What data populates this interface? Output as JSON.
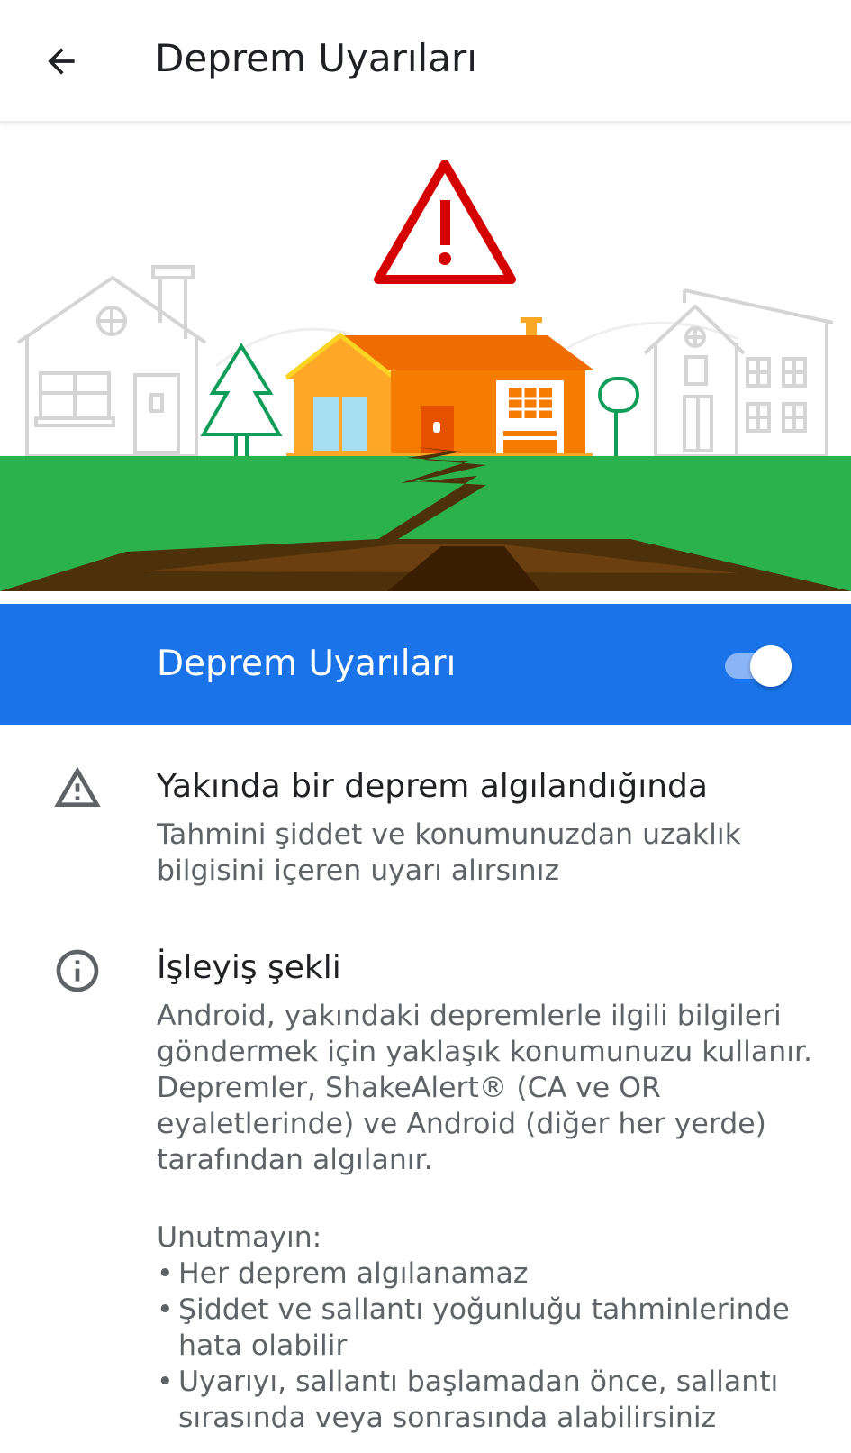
{
  "app_bar": {
    "back_icon": "arrow-back-icon",
    "title": "Deprem Uyarıları"
  },
  "hero": {
    "illustration": "earthquake-house-illustration",
    "colors": {
      "warning_red": "#d50000",
      "house_orange": "#f57c00",
      "grass_green": "#2bb24c",
      "crack_brown": "#4e2a06"
    }
  },
  "toggle": {
    "label": "Deprem Uyarıları",
    "checked": true,
    "bar_color": "#1a73e8"
  },
  "alert_info": {
    "icon": "warning-icon",
    "title": "Yakında bir deprem algılandığında",
    "body": "Tahmini şiddet ve konumunuzdan uzaklık bilgisini içeren uyarı alırsınız"
  },
  "how_it_works": {
    "icon": "info-icon",
    "title": "İşleyiş şekli",
    "body": "Android, yakındaki depremlerle ilgili bilgileri göndermek için yaklaşık konumunuzu kullanır. Depremler, ShakeAlert® (CA ve OR eyaletlerinde) ve Android (diğer her yerde) tarafından algılanır.",
    "note_heading": "Unutmayın:",
    "bullets": [
      "Her deprem algılanamaz",
      "Şiddet ve sallantı yoğunluğu tahminlerinde hata olabilir",
      "Uyarıyı, sallantı başlamadan önce, sallantı sırasında veya sonrasında alabilirsiniz"
    ]
  }
}
